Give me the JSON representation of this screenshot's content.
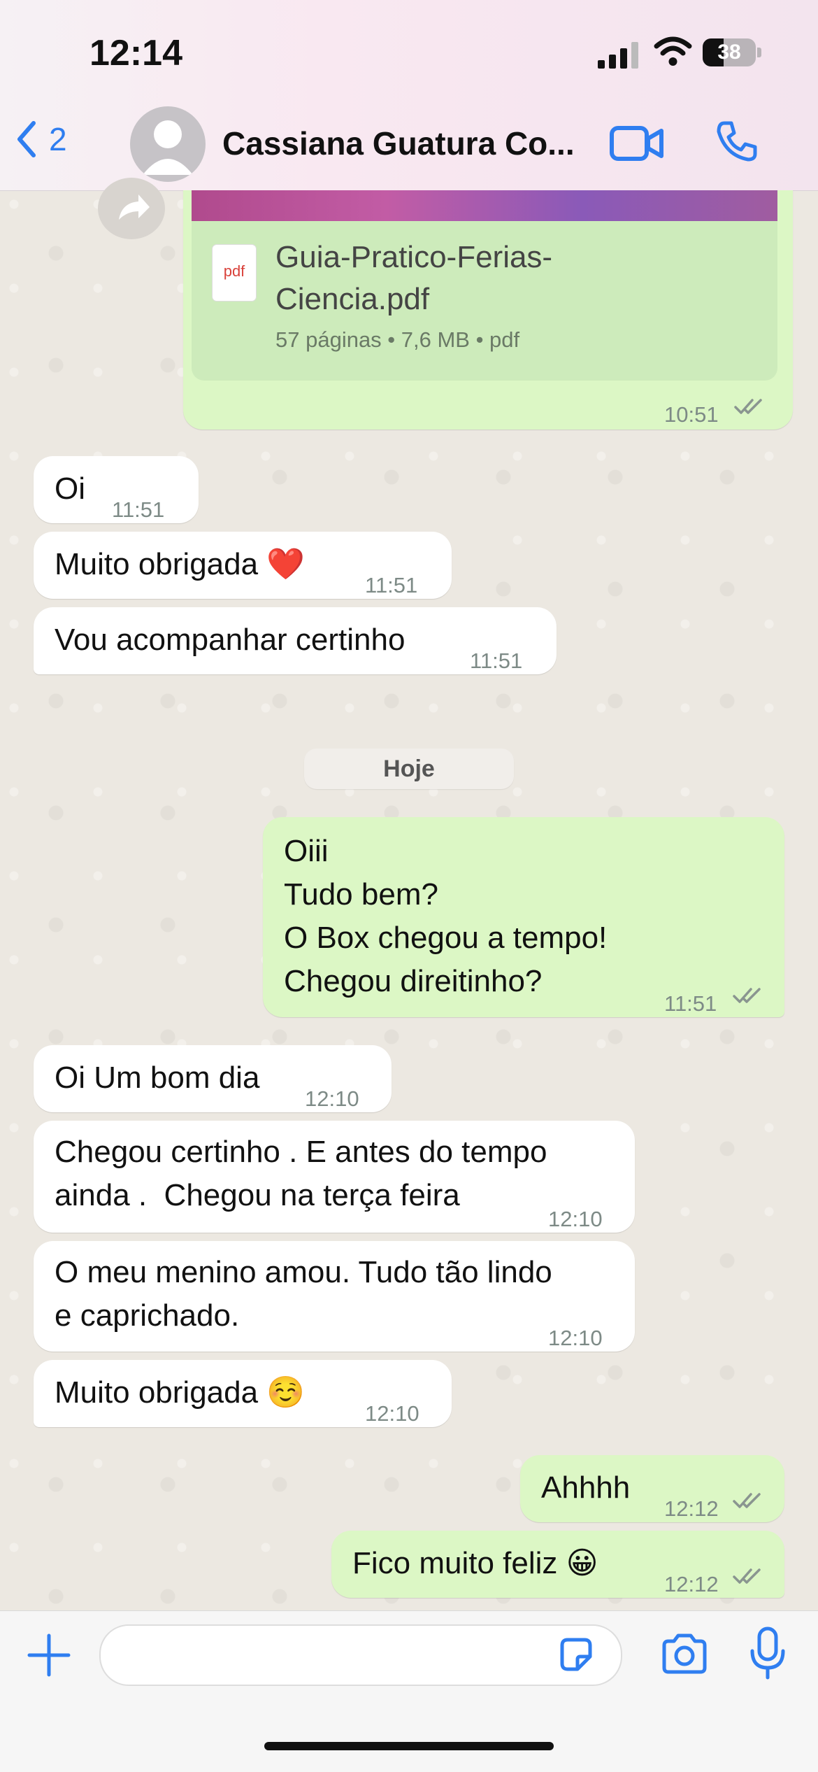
{
  "status": {
    "time": "12:14",
    "battery": "38"
  },
  "header": {
    "back_count": "2",
    "contact_name": "Cassiana Guatura Co..."
  },
  "file_message": {
    "icon_label": "pdf",
    "file_name_line1": "Guia-Pratico-Ferias-",
    "file_name_line2": "Ciencia.pdf",
    "meta": "57 páginas • 7,6 MB • pdf",
    "time": "10:51"
  },
  "messages": [
    {
      "text": "Oi",
      "time": "11:51"
    },
    {
      "text": "Muito obrigada ❤️",
      "time": "11:51"
    },
    {
      "text": "Vou acompanhar certinho",
      "time": "11:51"
    },
    {
      "text": "Oiii\nTudo bem?\nO Box chegou a tempo!\nChegou direitinho?",
      "time": "11:51"
    },
    {
      "text": "Oi Um bom dia",
      "time": "12:10"
    },
    {
      "text": "Chegou certinho . E antes do tempo\nainda .  Chegou na terça feira",
      "time": "12:10"
    },
    {
      "text": "O meu menino amou. Tudo tão lindo\ne caprichado.",
      "time": "12:10"
    },
    {
      "text": "Muito obrigada ☺️",
      "time": "12:10"
    },
    {
      "text": "Ahhhh",
      "time": "12:12"
    },
    {
      "text": "Fico muito feliz 😀",
      "time": "12:12"
    }
  ],
  "date_separator": "Hoje",
  "colors": {
    "accent": "#2f7ef0",
    "outgoing_bubble": "#dcf7c5",
    "incoming_bubble": "#ffffff"
  }
}
